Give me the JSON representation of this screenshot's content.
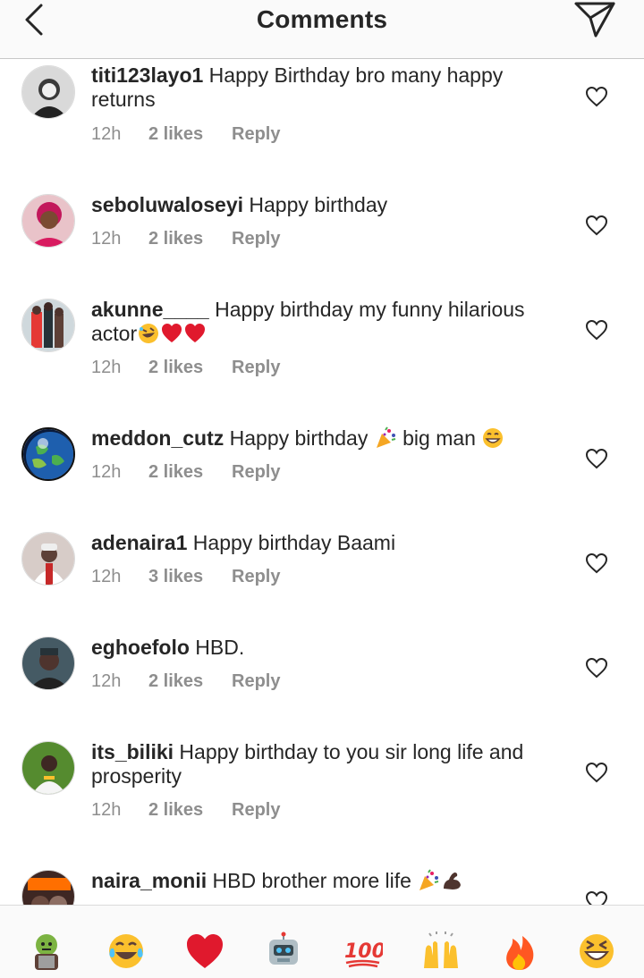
{
  "header": {
    "title": "Comments",
    "back_icon": "chevron-left-icon",
    "send_icon": "paper-plane-icon"
  },
  "comments": [
    {
      "user": "titi123layo1",
      "text": " Happy Birthday bro many happy returns",
      "time": "12h",
      "likes": "2 likes",
      "reply": "Reply"
    },
    {
      "user": "seboluwaloseyi",
      "text": " Happy birthday",
      "time": "12h",
      "likes": "2 likes",
      "reply": "Reply"
    },
    {
      "user": "akunne____",
      "text": " Happy birthday my funny hilarious actor",
      "emojis": [
        "rolling-laughing",
        "red-heart",
        "red-heart"
      ],
      "time": "12h",
      "likes": "2 likes",
      "reply": "Reply"
    },
    {
      "user": "meddon_cutz",
      "text": " Happy birthday",
      "emojis_mid": [
        "party-popper"
      ],
      "text2": " big man ",
      "emojis_end": [
        "grinning"
      ],
      "time": "12h",
      "likes": "2 likes",
      "reply": "Reply"
    },
    {
      "user": "adenaira1",
      "text": " Happy birthday Baami",
      "time": "12h",
      "likes": "3 likes",
      "reply": "Reply"
    },
    {
      "user": "eghoefolo",
      "text": " HBD.",
      "time": "12h",
      "likes": "2 likes",
      "reply": "Reply"
    },
    {
      "user": "its_biliki",
      "text": " Happy birthday to you sir long life and prosperity",
      "time": "12h",
      "likes": "2 likes",
      "reply": "Reply"
    },
    {
      "user": "naira_monii",
      "text": " HBD brother more life ",
      "emojis": [
        "party-popper",
        "flexed-biceps"
      ]
    }
  ],
  "emoji_bar": [
    "zombie",
    "tears-of-joy",
    "red-heart",
    "robot",
    "hundred-points",
    "raising-hands",
    "fire",
    "grinning-squinting"
  ],
  "colors": {
    "text": "#262626",
    "secondary": "#8e8e8e",
    "header_bg": "#fafafa",
    "divider": "#c8c8c8"
  }
}
